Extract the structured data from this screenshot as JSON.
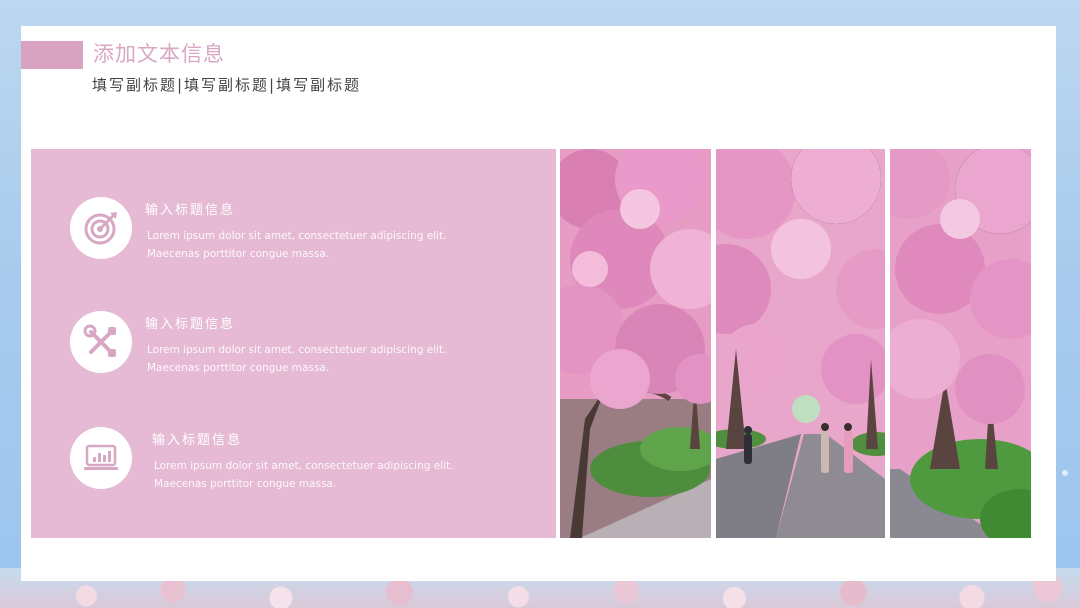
{
  "header": {
    "title": "添加文本信息",
    "subtitle": "填写副标题|填写副标题|填写副标题"
  },
  "features": [
    {
      "title": "输入标题信息",
      "text": "Lorem ipsum dolor sit amet, consectetuer adipiscing elit. Maecenas porttitor congue massa.",
      "icon": "target-icon"
    },
    {
      "title": "输入标题信息",
      "text": "Lorem ipsum dolor sit amet, consectetuer adipiscing elit. Maecenas porttitor congue massa.",
      "icon": "tools-icon"
    },
    {
      "title": "输入标题信息",
      "text": "Lorem ipsum dolor sit amet, consectetuer adipiscing elit. Maecenas porttitor congue massa.",
      "icon": "laptop-chart-icon"
    }
  ],
  "colors": {
    "accent_pink": "#d7a3c1",
    "panel_pink": "#e6bad4",
    "title_pink": "#d8a7c4",
    "background_blue": "#a8cbed"
  }
}
